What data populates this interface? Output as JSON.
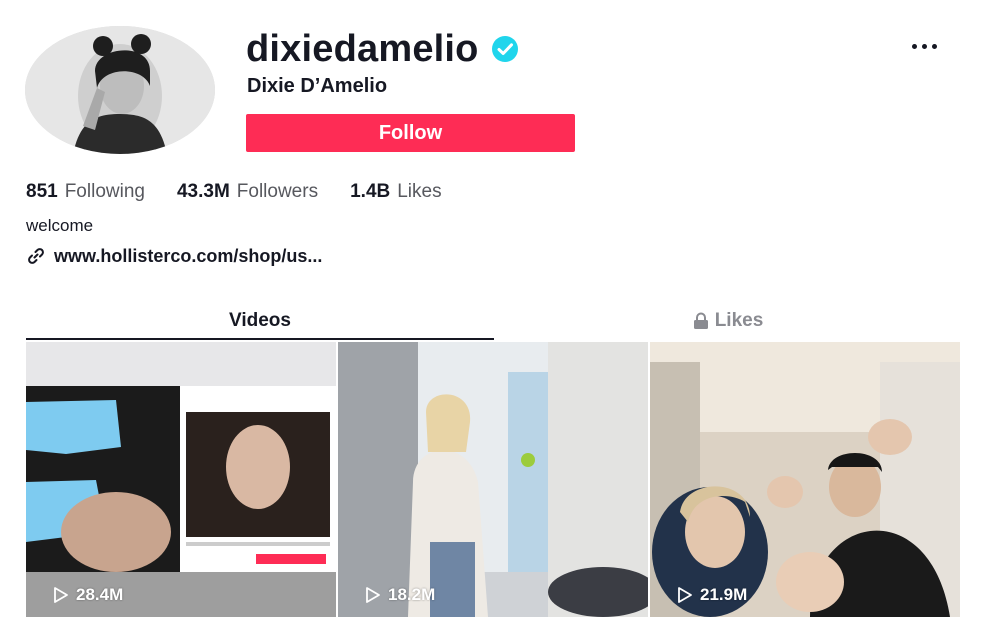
{
  "profile": {
    "username": "dixiedamelio",
    "display_name": "Dixie D’Amelio",
    "verified": true,
    "follow_label": "Follow",
    "bio": "welcome",
    "link": "www.hollisterco.com/shop/us..."
  },
  "stats": [
    {
      "value": "851",
      "label": "Following"
    },
    {
      "value": "43.3M",
      "label": "Followers"
    },
    {
      "value": "1.4B",
      "label": "Likes"
    }
  ],
  "tabs": [
    {
      "label": "Videos",
      "active": true
    },
    {
      "label": "Likes",
      "locked": true
    }
  ],
  "videos": [
    {
      "views": "28.4M"
    },
    {
      "views": "18.2M"
    },
    {
      "views": "21.9M"
    }
  ],
  "colors": {
    "follow_button": "#fe2c55",
    "verified_badge": "#20d5ec",
    "text_primary": "#161823",
    "text_secondary": "#57585e",
    "inactive_tab": "#8a8b91"
  },
  "icons": {
    "verified": "verified-check-icon",
    "more": "ellipsis-icon",
    "link": "chain-link-icon",
    "lock": "lock-icon",
    "play": "play-outline-icon"
  }
}
